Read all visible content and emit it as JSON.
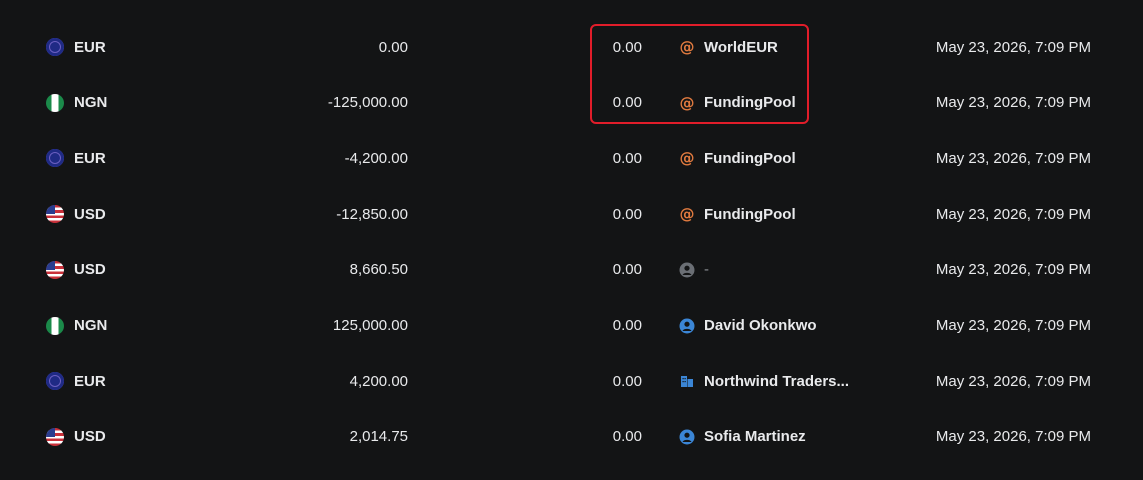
{
  "rows": [
    {
      "currency": "EUR",
      "flag": "eu",
      "amount": "0.00",
      "fee": "0.00",
      "counterparty": "WorldEUR",
      "cp_icon": "at-icon",
      "date": "May 23, 2026, 7:09 PM"
    },
    {
      "currency": "NGN",
      "flag": "ng",
      "amount": "-125,000.00",
      "fee": "0.00",
      "counterparty": "FundingPool",
      "cp_icon": "at-icon",
      "date": "May 23, 2026, 7:09 PM"
    },
    {
      "currency": "EUR",
      "flag": "eu",
      "amount": "-4,200.00",
      "fee": "0.00",
      "counterparty": "FundingPool",
      "cp_icon": "at-icon",
      "date": "May 23, 2026, 7:09 PM"
    },
    {
      "currency": "USD",
      "flag": "us",
      "amount": "-12,850.00",
      "fee": "0.00",
      "counterparty": "FundingPool",
      "cp_icon": "at-icon",
      "date": "May 23, 2026, 7:09 PM"
    },
    {
      "currency": "USD",
      "flag": "us",
      "amount": "8,660.50",
      "fee": "0.00",
      "counterparty": "-",
      "cp_icon": "user-icon-muted",
      "date": "May 23, 2026, 7:09 PM"
    },
    {
      "currency": "NGN",
      "flag": "ng",
      "amount": "125,000.00",
      "fee": "0.00",
      "counterparty": "David Okonkwo",
      "cp_icon": "user-icon",
      "date": "May 23, 2026, 7:09 PM"
    },
    {
      "currency": "EUR",
      "flag": "eu",
      "amount": "4,200.00",
      "fee": "0.00",
      "counterparty": "Northwind Traders...",
      "cp_icon": "building-icon",
      "date": "May 23, 2026, 7:09 PM"
    },
    {
      "currency": "USD",
      "flag": "us",
      "amount": "2,014.75",
      "fee": "0.00",
      "counterparty": "Sofia Martinez",
      "cp_icon": "user-icon",
      "date": "May 23, 2026, 7:09 PM"
    }
  ],
  "colors": {
    "background": "#131415",
    "text": "#e9eaec",
    "at_icon": "#e07a3f",
    "user_icon": "#3b86d6",
    "user_icon_muted": "#6b6f75",
    "highlight": "#e11d2a"
  }
}
